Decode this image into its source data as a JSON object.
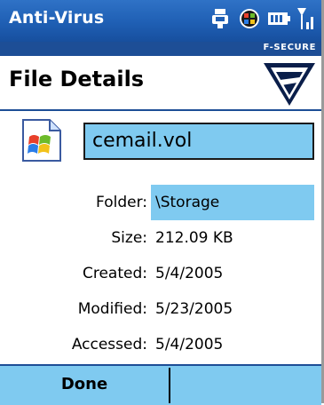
{
  "titlebar": {
    "title": "Anti-Virus",
    "icons": [
      "connectivity-icon",
      "start-menu-icon",
      "battery-icon",
      "signal-icon"
    ]
  },
  "brand": {
    "label": "F-SECURE"
  },
  "header": {
    "heading": "File Details"
  },
  "file": {
    "name": "cemail.vol",
    "icon": "file-icon"
  },
  "details": [
    {
      "label": "Folder:",
      "value": "\\Storage",
      "selected": true
    },
    {
      "label": "Size:",
      "value": "212.09 KB"
    },
    {
      "label": "Created:",
      "value": "5/4/2005"
    },
    {
      "label": "Modified:",
      "value": "5/23/2005"
    },
    {
      "label": "Accessed:",
      "value": "5/4/2005"
    }
  ],
  "softkeys": {
    "left": "Done",
    "right": ""
  },
  "colors": {
    "titlebar": "#1f5fb4",
    "highlight": "#7fcaf0",
    "brand_strip": "#1d4e96"
  }
}
